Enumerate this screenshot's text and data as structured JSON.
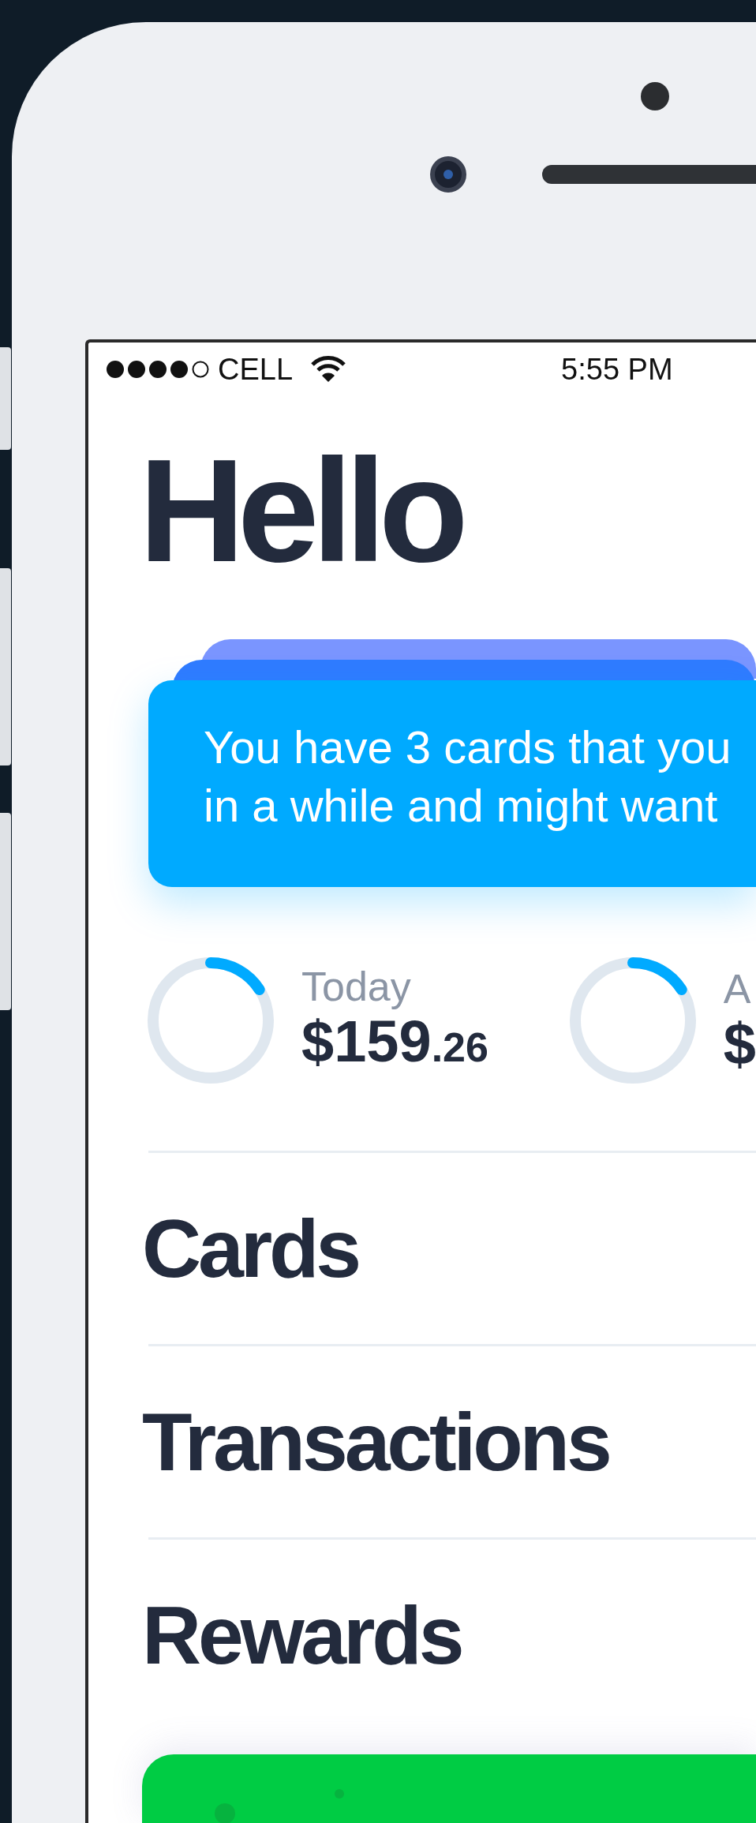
{
  "status_bar": {
    "carrier": "CELL",
    "time": "5:55 PM"
  },
  "greeting": "Hello",
  "notice": {
    "text": "You have 3 cards that you\nin a while and might want"
  },
  "stats": [
    {
      "label": "Today",
      "amount": "$159",
      "cents": ".26",
      "level": 0.16
    },
    {
      "label": "A",
      "amount": "$",
      "level": 0.16
    }
  ],
  "sections": [
    {
      "title": "Cards"
    },
    {
      "title": "Transactions"
    },
    {
      "title": "Rewards"
    }
  ]
}
